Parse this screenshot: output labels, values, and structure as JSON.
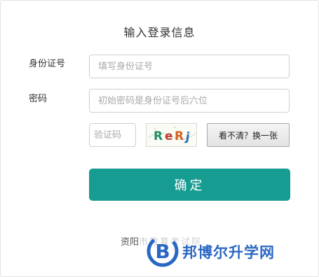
{
  "form": {
    "title": "输入登录信息",
    "id_label": "身份证号",
    "id_placeholder": "填写身份证号",
    "password_label": "密码",
    "password_placeholder": "初始密码是身份证号后六位",
    "captcha_placeholder": "验证码",
    "captcha_chars": [
      "R",
      "e",
      "R",
      "j"
    ],
    "captcha_colors": [
      "#1f8f62",
      "#c0392b",
      "#d4601f",
      "#2d6cc0"
    ],
    "refresh_label": "看不清？换一张",
    "submit_label": "确定",
    "accent_color": "#179c92"
  },
  "footer": {
    "text": "资阳",
    "faint_text": "市教育考试院"
  },
  "watermark": {
    "letter": "B",
    "text": "邦博尔升学网",
    "color": "#2a67c4"
  }
}
